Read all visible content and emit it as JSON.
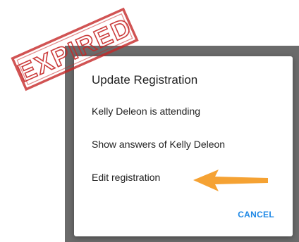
{
  "dialog": {
    "title": "Update Registration",
    "items": [
      "Kelly Deleon is attending",
      "Show answers of Kelly Deleon",
      "Edit registration"
    ],
    "cancel_label": "CANCEL"
  },
  "stamp": {
    "text": "EXPIRED",
    "color": "#c62828"
  },
  "annotation": {
    "arrow_color": "#f5a233",
    "arrow_direction": "left",
    "points_to": "Edit registration"
  },
  "colors": {
    "overlay": "#6b6b6b",
    "accent": "#1e88e5"
  }
}
